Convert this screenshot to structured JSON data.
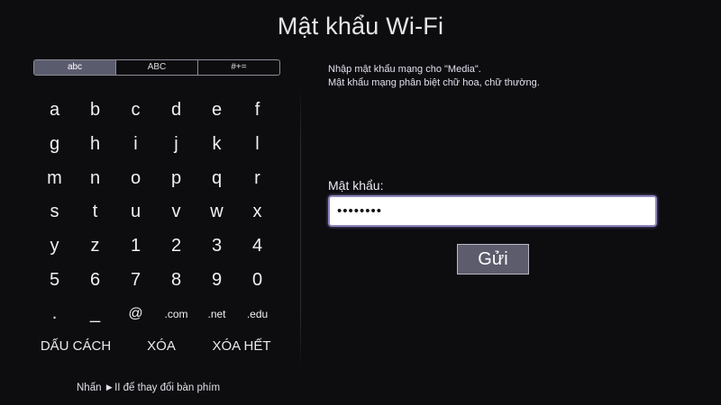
{
  "title": "Mật khẩu Wi-Fi",
  "keyboard": {
    "modes": [
      "abc",
      "ABC",
      "#+="
    ],
    "active_mode": "abc",
    "rows": [
      [
        "a",
        "b",
        "c",
        "d",
        "e",
        "f"
      ],
      [
        "g",
        "h",
        "i",
        "j",
        "k",
        "l"
      ],
      [
        "m",
        "n",
        "o",
        "p",
        "q",
        "r"
      ],
      [
        "s",
        "t",
        "u",
        "v",
        "w",
        "x"
      ],
      [
        "y",
        "z",
        "1",
        "2",
        "3",
        "4"
      ],
      [
        "5",
        "6",
        "7",
        "8",
        "9",
        "0"
      ],
      [
        ".",
        "_",
        "@",
        ".com",
        ".net",
        ".edu"
      ]
    ],
    "space_label": "DẤU CÁCH",
    "delete_label": "XÓA",
    "clear_label": "XÓA HẾT"
  },
  "hint": "Nhấn ►II để thay đổi bàn phím",
  "prompt": {
    "line1": "Nhập mật khẩu mạng cho \"Media\".",
    "line2": "Mật khẩu mạng phân biệt chữ hoa, chữ thường."
  },
  "password": {
    "label": "Mật khẩu:",
    "value": "••••••••"
  },
  "submit_label": "Gửi"
}
